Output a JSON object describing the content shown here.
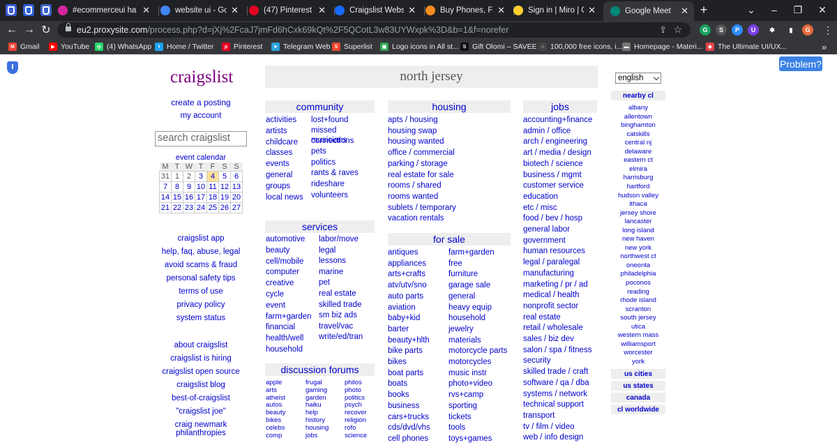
{
  "tabs": [
    {
      "label": "#ecommerceui ha",
      "favicon": "instagram-icon",
      "color": "#d6249f"
    },
    {
      "label": "website ui - Googl",
      "favicon": "google-icon",
      "color": "#4285f4"
    },
    {
      "label": "(47) Pinterest",
      "favicon": "pinterest-icon",
      "color": "#e60023"
    },
    {
      "label": "Craigslist Website",
      "favicon": "behance-icon",
      "color": "#1769ff"
    },
    {
      "label": "Buy Phones, Fashic",
      "favicon": "shop-icon",
      "color": "#f68b1e"
    },
    {
      "label": "Sign in | Miro | On",
      "favicon": "miro-icon",
      "color": "#ffd02f"
    },
    {
      "label": "Google Meet",
      "favicon": "meet-icon",
      "color": "#00897b"
    }
  ],
  "new_tab": "+",
  "url": {
    "host": "eu2.proxysite.com",
    "path": "/process.php?d=jXj%2FcaJ7jmFd6hCxk69kQt%2F5QCotL3w83UYWxpk%3D&b=1&f=norefer"
  },
  "toolbar_icons": [
    {
      "name": "g-extension-icon",
      "text": "G",
      "color": "#1aa260"
    },
    {
      "name": "s-extension-icon",
      "text": "S",
      "color": "#555"
    },
    {
      "name": "p-extension-icon",
      "text": "P",
      "color": "#2d8cff"
    },
    {
      "name": "u-extension-icon",
      "text": "U",
      "color": "#7b3fe4"
    },
    {
      "name": "puzzle-icon",
      "text": "✱",
      "color": "#35363a"
    },
    {
      "name": "sidepanel-icon",
      "text": "▮",
      "color": "#35363a"
    },
    {
      "name": "profile-icon",
      "text": "G",
      "color": "#e66a3c"
    }
  ],
  "bookmarks": [
    {
      "label": "Gmail",
      "icon": "gmail-icon",
      "color": "#ea4335",
      "glyph": "M"
    },
    {
      "label": "YouTube",
      "icon": "youtube-icon",
      "color": "#ff0000",
      "glyph": "▶"
    },
    {
      "label": "(4) WhatsApp",
      "icon": "whatsapp-icon",
      "color": "#25d366",
      "glyph": "◎"
    },
    {
      "label": "Home / Twitter",
      "icon": "twitter-icon",
      "color": "#1da1f2",
      "glyph": "t"
    },
    {
      "label": "Pinterest",
      "icon": "pinterest-icon",
      "color": "#e60023",
      "glyph": "p"
    },
    {
      "label": "Telegram Web",
      "icon": "telegram-icon",
      "color": "#2aa3df",
      "glyph": "➤"
    },
    {
      "label": "Superlist",
      "icon": "superlist-icon",
      "color": "#f2462e",
      "glyph": "S"
    },
    {
      "label": "Logo icons in All st...",
      "icon": "logo-icons-icon",
      "color": "#2ea44f",
      "glyph": "▣"
    },
    {
      "label": "Gift Olomi – SAVEE",
      "icon": "savee-icon",
      "color": "#111",
      "glyph": "S"
    },
    {
      "label": "100,000 free icons, i...",
      "icon": "icons-icon",
      "color": "#444",
      "glyph": "○"
    },
    {
      "label": "Homepage - Materi...",
      "icon": "material-icon",
      "color": "#757575",
      "glyph": "▬"
    },
    {
      "label": "The Ultimate UI/UX...",
      "icon": "uiux-icon",
      "color": "#e04646",
      "glyph": "◆"
    }
  ],
  "more_bookmarks": "»",
  "problem_button": "Problem?",
  "logo": "craigslist",
  "create_posting": "create a posting",
  "my_account": "my account",
  "search_placeholder": "search craigslist",
  "event_calendar": "event calendar",
  "calendar": {
    "days": [
      "M",
      "T",
      "W",
      "T",
      "F",
      "S",
      "S"
    ],
    "weeks": [
      [
        "31",
        "1",
        "2",
        "3",
        "4",
        "5",
        "6"
      ],
      [
        "7",
        "8",
        "9",
        "10",
        "11",
        "12",
        "13"
      ],
      [
        "14",
        "15",
        "16",
        "17",
        "18",
        "19",
        "20"
      ],
      [
        "21",
        "22",
        "23",
        "24",
        "25",
        "26",
        "27"
      ]
    ],
    "today": "4"
  },
  "left_links": [
    "craigslist app",
    "help, faq, abuse, legal",
    "avoid scams & fraud",
    "personal safety tips",
    "terms of use",
    "privacy policy",
    "system status",
    "about craigslist",
    "craigslist is hiring",
    "craigslist open source",
    "craigslist blog",
    "best-of-craigslist",
    "\"craigslist joe\"",
    "craig newmark philanthropies"
  ],
  "location": "north jersey",
  "community": {
    "title": "community",
    "col1": [
      "activities",
      "artists",
      "childcare",
      "classes",
      "events",
      "general",
      "groups",
      "local news"
    ],
    "col2": [
      "lost+found",
      "missed connections",
      "musicians",
      "pets",
      "politics",
      "rants & raves",
      "rideshare",
      "volunteers"
    ]
  },
  "services": {
    "title": "services",
    "col1": [
      "automotive",
      "beauty",
      "cell/mobile",
      "computer",
      "creative",
      "cycle",
      "event",
      "farm+garden",
      "financial",
      "health/well",
      "household"
    ],
    "col2": [
      "labor/move",
      "legal",
      "lessons",
      "marine",
      "pet",
      "real estate",
      "skilled trade",
      "sm biz ads",
      "travel/vac",
      "write/ed/tran"
    ]
  },
  "forums": {
    "title": "discussion forums",
    "col1": [
      "apple",
      "arts",
      "atheist",
      "autos",
      "beauty",
      "bikes",
      "celebs",
      "comp"
    ],
    "col2": [
      "frugal",
      "gaming",
      "garden",
      "haiku",
      "help",
      "history",
      "housing",
      "jobs"
    ],
    "col3": [
      "philos",
      "photo",
      "politics",
      "psych",
      "recover",
      "religion",
      "rofo",
      "science"
    ]
  },
  "housing": {
    "title": "housing",
    "items": [
      "apts / housing",
      "housing swap",
      "housing wanted",
      "office / commercial",
      "parking / storage",
      "real estate for sale",
      "rooms / shared",
      "rooms wanted",
      "sublets / temporary",
      "vacation rentals"
    ]
  },
  "for_sale": {
    "title": "for sale",
    "col1": [
      "antiques",
      "appliances",
      "arts+crafts",
      "atv/utv/sno",
      "auto parts",
      "aviation",
      "baby+kid",
      "barter",
      "beauty+hlth",
      "bike parts",
      "bikes",
      "boat parts",
      "boats",
      "books",
      "business",
      "cars+trucks",
      "cds/dvd/vhs",
      "cell phones"
    ],
    "col2": [
      "farm+garden",
      "free",
      "furniture",
      "garage sale",
      "general",
      "heavy equip",
      "household",
      "jewelry",
      "materials",
      "motorcycle parts",
      "motorcycles",
      "music instr",
      "photo+video",
      "rvs+camp",
      "sporting",
      "tickets",
      "tools",
      "toys+games"
    ]
  },
  "jobs": {
    "title": "jobs",
    "items": [
      "accounting+finance",
      "admin / office",
      "arch / engineering",
      "art / media / design",
      "biotech / science",
      "business / mgmt",
      "customer service",
      "education",
      "etc / misc",
      "food / bev / hosp",
      "general labor",
      "government",
      "human resources",
      "legal / paralegal",
      "manufacturing",
      "marketing / pr / ad",
      "medical / health",
      "nonprofit sector",
      "real estate",
      "retail / wholesale",
      "sales / biz dev",
      "salon / spa / fitness",
      "security",
      "skilled trade / craft",
      "software / qa / dba",
      "systems / network",
      "technical support",
      "transport",
      "tv / film / video",
      "web / info design"
    ]
  },
  "language": "english",
  "nearby_title": "nearby cl",
  "nearby": [
    "albany",
    "allentown",
    "binghamton",
    "catskills",
    "central nj",
    "delaware",
    "eastern ct",
    "elmira",
    "harrisburg",
    "hartford",
    "hudson valley",
    "ithaca",
    "jersey shore",
    "lancaster",
    "long island",
    "new haven",
    "new york",
    "northwest ct",
    "oneonta",
    "philadelphia",
    "poconos",
    "reading",
    "rhode island",
    "scranton",
    "south jersey",
    "utica",
    "western mass",
    "williamsport",
    "worcester",
    "york"
  ],
  "us_cities": "us cities",
  "us_states": "us states",
  "canada": "canada",
  "worldwide": "cl worldwide"
}
